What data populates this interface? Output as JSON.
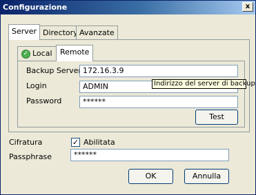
{
  "window": {
    "title": "Configurazione",
    "close_label": "x"
  },
  "tabs": {
    "server": "Server",
    "directory": "Directory",
    "advanced": "Avanzate"
  },
  "inner_tabs": {
    "local": "Local",
    "remote": "Remote"
  },
  "remote": {
    "backup_server_label": "Backup Server",
    "backup_server_value": "172.16.3.9",
    "login_label": "Login",
    "login_value": "ADMIN",
    "password_label": "Password",
    "password_value": "******",
    "test_button": "Test"
  },
  "tooltip": "Indirizzo del server di backup",
  "encryption": {
    "label": "Cifratura",
    "checkbox_label": "Abilitata",
    "checked": true,
    "passphrase_label": "Passphrase",
    "passphrase_value": "******"
  },
  "buttons": {
    "ok": "OK",
    "cancel": "Annulla"
  },
  "icons": {
    "local_tab_icon": "green-check-circle-icon",
    "close": "close-icon"
  },
  "colors": {
    "titlebar_start": "#0a246a",
    "titlebar_end": "#a6caf0",
    "dialog_bg": "#ece9d8",
    "tooltip_bg": "#ffffe1"
  }
}
